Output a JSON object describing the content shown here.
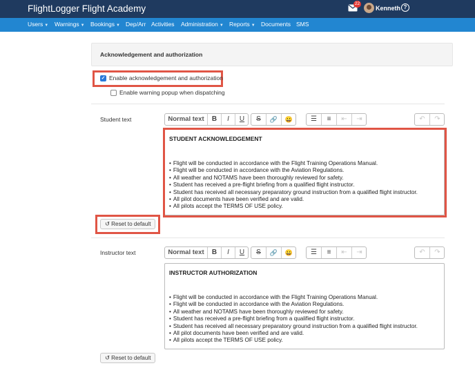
{
  "app": {
    "title": "FlightLogger Flight Academy"
  },
  "header": {
    "mail_badge": "22",
    "user_name": "Kenneth",
    "help_label": "?"
  },
  "nav": {
    "items": [
      {
        "label": "Users",
        "caret": true
      },
      {
        "label": "Warnings",
        "caret": true
      },
      {
        "label": "Bookings",
        "caret": true
      },
      {
        "label": "Dep/Arr",
        "caret": false
      },
      {
        "label": "Activities",
        "caret": false
      },
      {
        "label": "Administration",
        "caret": true
      },
      {
        "label": "Reports",
        "caret": true
      },
      {
        "label": "Documents",
        "caret": false
      },
      {
        "label": "SMS",
        "caret": false
      }
    ]
  },
  "section": {
    "title": "Acknowledgement and authorization"
  },
  "options": {
    "enable_ack": {
      "label": "Enable acknowledgement and authorization",
      "checked": true
    },
    "warning_popup": {
      "label": "Enable warning popup when dispatching",
      "checked": false
    }
  },
  "toolbar": {
    "format_label": "Normal text",
    "buttons": [
      "bold-icon",
      "italic-icon",
      "underline-icon",
      "strikethrough-icon",
      "link-icon",
      "emoji-icon",
      "bullet-list-icon",
      "numbered-list-icon",
      "outdent-icon",
      "indent-icon",
      "undo-icon",
      "redo-icon"
    ]
  },
  "student": {
    "label": "Student text",
    "heading": "STUDENT ACKNOWLEDGEMENT",
    "items": [
      "Flight will be conducted in accordance with the Flight Training Operations Manual.",
      "Flight will be conducted in accordance with the Aviation Regulations.",
      "All weather and NOTAMS have been thoroughly reviewed for safety.",
      "Student has received a pre-flight briefing from a qualified flight instructor.",
      "Student has received all necessary preparatory ground instruction from a qualified flight instructor.",
      "All pilot documents have been verified and are valid.",
      "All pilots accept the TERMS OF USE policy."
    ],
    "reset_label": "Reset to default"
  },
  "instructor": {
    "label": "Instructor text",
    "heading": "INSTRUCTOR AUTHORIZATION",
    "items": [
      "Flight will be conducted in accordance with the Flight Training Operations Manual.",
      "Flight will be conducted in accordance with the Aviation Regulations.",
      "All weather and NOTAMS have been thoroughly reviewed for safety.",
      "Student has received a pre-flight briefing from a qualified flight instructor.",
      "Student has received all necessary preparatory ground instruction from a qualified flight instructor.",
      "All pilot documents have been verified and are valid.",
      "All pilots accept the TERMS OF USE policy."
    ],
    "reset_label": "Reset to default"
  },
  "colors": {
    "topbar": "#1f3a5f",
    "navbar": "#2286d1",
    "highlight": "#e05545",
    "checkbox": "#2979d9"
  }
}
